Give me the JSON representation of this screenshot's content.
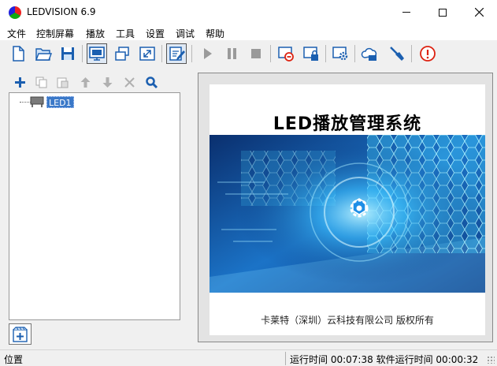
{
  "window": {
    "title": "LEDVISION 6.9",
    "minimize_icon": "minimize-icon",
    "maximize_icon": "maximize-icon",
    "close_icon": "close-icon"
  },
  "menu": {
    "items": [
      "文件",
      "控制屏幕",
      "播放",
      "工具",
      "设置",
      "调试",
      "帮助"
    ]
  },
  "toolbar": {
    "buttons": [
      {
        "icon": "new-file-icon"
      },
      {
        "icon": "open-folder-icon"
      },
      {
        "icon": "save-icon"
      },
      {
        "icon": "screen-monitor-icon",
        "pressed": true
      },
      {
        "icon": "windows-icon"
      },
      {
        "icon": "fullscreen-icon"
      },
      {
        "icon": "edit-icon",
        "pressed": true
      },
      {
        "icon": "play-icon"
      },
      {
        "icon": "pause-icon"
      },
      {
        "icon": "stop-icon"
      },
      {
        "icon": "screen-off-icon"
      },
      {
        "icon": "screen-lock-icon"
      },
      {
        "icon": "screen-settings-icon"
      },
      {
        "icon": "cloud-icon"
      },
      {
        "icon": "broom-icon"
      },
      {
        "icon": "info-icon"
      }
    ]
  },
  "left_toolbar": {
    "buttons": [
      "add-icon",
      "copy-icon",
      "paste-icon",
      "move-up-icon",
      "move-down-icon",
      "delete-icon",
      "search-icon"
    ]
  },
  "tree": {
    "items": [
      {
        "label": "LED1",
        "icon": "led-screen-icon",
        "selected": true
      }
    ]
  },
  "preview": {
    "title": "LED播放管理系统",
    "copyright": "卡莱特（深圳）云科技有限公司  版权所有",
    "colors": {
      "banner_dark": "#0a2f6e",
      "banner_light": "#2ec8ff",
      "background": "#ffffff"
    }
  },
  "status": {
    "position_label": "位置",
    "runtime_label": "运行时间",
    "runtime_value": "00:07:38",
    "software_runtime_label": "软件运行时间",
    "software_runtime_value": "00:00:32"
  }
}
